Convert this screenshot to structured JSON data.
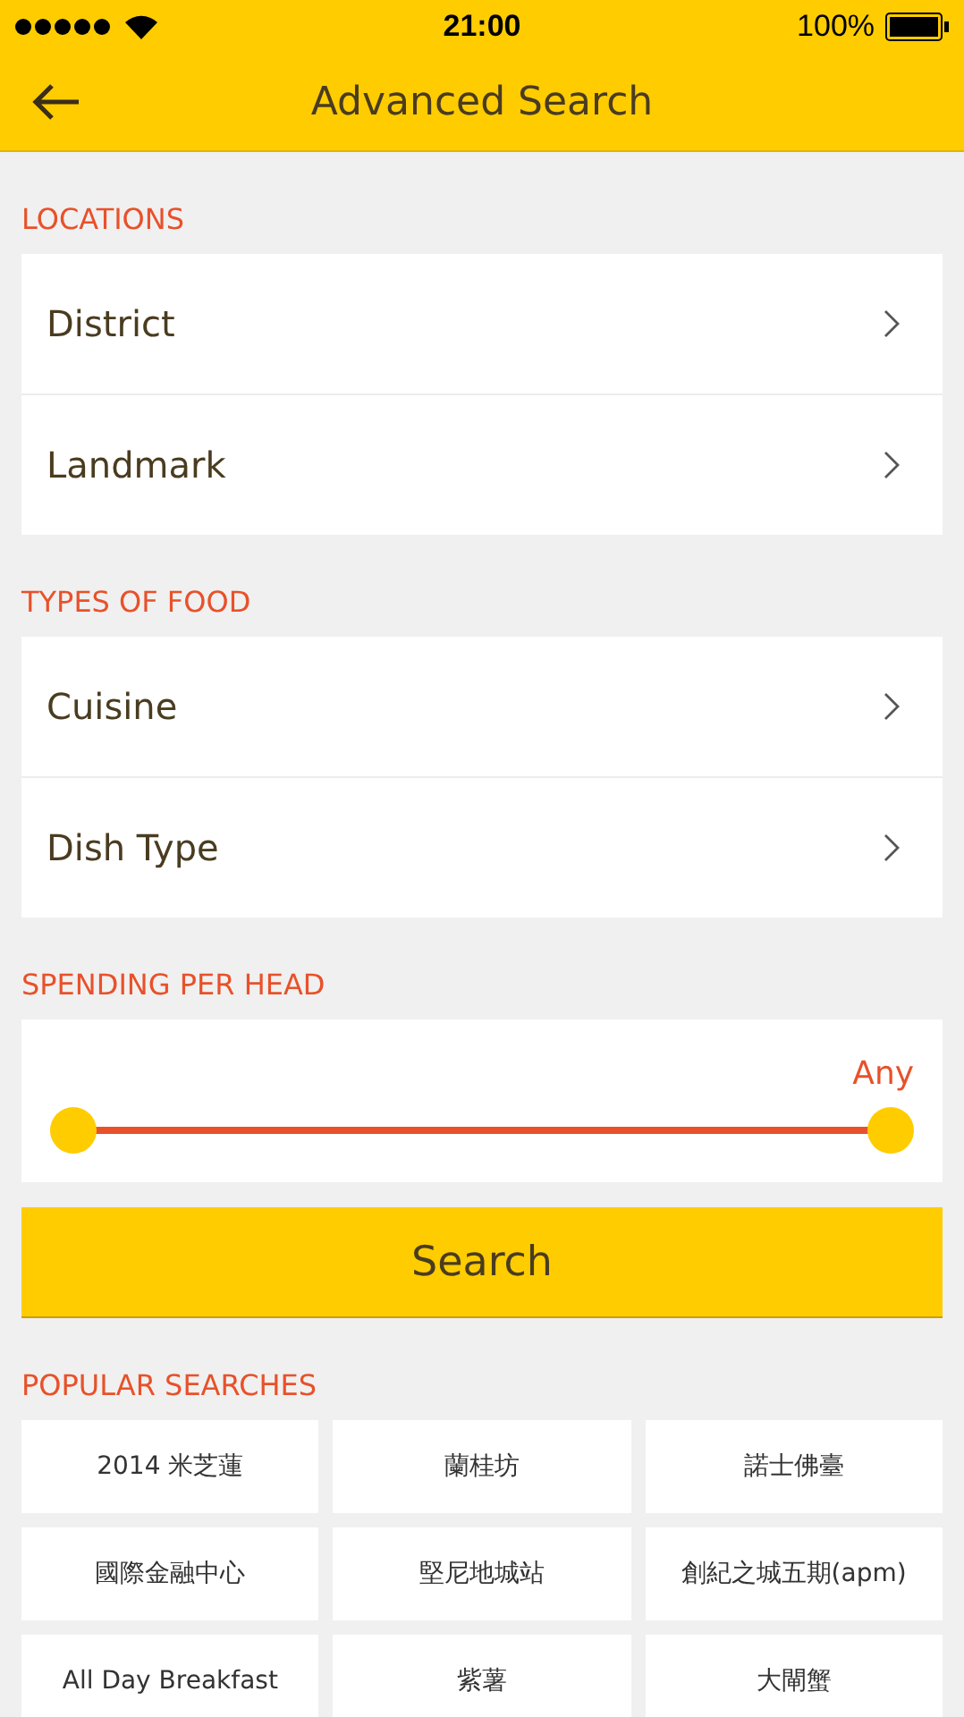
{
  "status_bar": {
    "time": "21:00",
    "battery": "100%"
  },
  "header": {
    "title": "Advanced Search"
  },
  "sections": [
    {
      "title": "LOCATIONS",
      "items": [
        "District",
        "Landmark"
      ]
    },
    {
      "title": "TYPES OF FOOD",
      "items": [
        "Cuisine",
        "Dish Type"
      ]
    }
  ],
  "spending": {
    "title": "SPENDING PER HEAD",
    "reading": "Any",
    "thumbs": [
      {
        "level": 0
      },
      {
        "level": 1
      }
    ]
  },
  "search_button": "Search",
  "popular": {
    "title": "POPULAR SEARCHES",
    "items": [
      "2014 米芝蓮",
      "蘭桂坊",
      "諾士佛臺",
      "國際金融中心",
      "堅尼地城站",
      "創紀之城五期(apm)",
      "All Day Breakfast",
      "紫薯",
      "大閘蟹"
    ]
  }
}
